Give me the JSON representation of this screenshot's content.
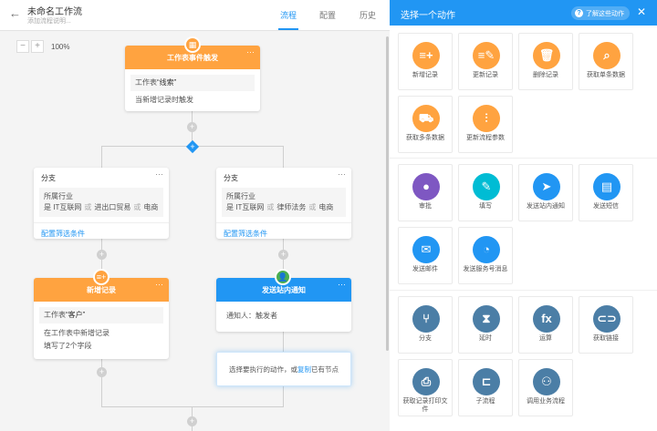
{
  "header": {
    "back_icon": "back-arrow-icon",
    "title": "未命名工作流",
    "description": "添加流程说明...",
    "tabs": [
      {
        "label": "流程",
        "active": true
      },
      {
        "label": "配置",
        "active": false
      },
      {
        "label": "历史",
        "active": false
      }
    ]
  },
  "canvas": {
    "zoom_out": "−",
    "zoom_in": "+",
    "zoom_level": "100%",
    "trigger": {
      "title": "工作表事件触发",
      "icon": "table-icon",
      "sheet_label": "工作表",
      "sheet_name": "“线索”",
      "desc": "当新增记录时触发",
      "more": "···"
    },
    "branches": [
      {
        "title": "分支",
        "more": "···",
        "field": "所属行业",
        "is_label": "是",
        "values": [
          "IT互联网",
          "进出口贸易",
          "电商"
        ],
        "or": "或",
        "footer": "配置筛选条件"
      },
      {
        "title": "分支",
        "more": "···",
        "field": "所属行业",
        "is_label": "是",
        "values": [
          "IT互联网",
          "律师法务",
          "电商"
        ],
        "or": "或",
        "footer": "配置筛选条件"
      }
    ],
    "add_record_node": {
      "title": "新增记录",
      "icon": "add-record-icon",
      "more": "···",
      "sheet_label": "工作表",
      "sheet_name": "“客户”",
      "line1": "在工作表中新增记录",
      "line2": "填写了2个字段"
    },
    "notify_node": {
      "title": "发送站内通知",
      "icon": "user-icon",
      "more": "···",
      "line1": "通知人：触发者"
    },
    "hint": {
      "before": "选择要执行的动作，或",
      "link": "复制",
      "after": "已有节点"
    }
  },
  "panel": {
    "title": "选择一个动作",
    "learn_label": "了解这些动作",
    "learn_icon": "help-icon",
    "close_icon": "close-icon",
    "groups": [
      [
        {
          "label": "新增记录",
          "icon": "add-record-icon",
          "glyph": "≡+",
          "color": "#ffa340"
        },
        {
          "label": "更新记录",
          "icon": "edit-record-icon",
          "glyph": "≡✎",
          "color": "#ffa340"
        },
        {
          "label": "删除记录",
          "icon": "trash-icon",
          "glyph": "🗑",
          "color": "#ffa340"
        },
        {
          "label": "获取单条数据",
          "icon": "search-icon",
          "glyph": "⌕",
          "color": "#ffa340"
        },
        {
          "label": "获取多条数据",
          "icon": "truck-icon",
          "glyph": "⛟",
          "color": "#ffa340"
        },
        {
          "label": "更新流程参数",
          "icon": "sliders-icon",
          "glyph": "⫶",
          "color": "#ffa340"
        }
      ],
      [
        {
          "label": "审批",
          "icon": "approver-icon",
          "glyph": "●",
          "color": "#7e57c2"
        },
        {
          "label": "填写",
          "icon": "pen-icon",
          "glyph": "✎",
          "color": "#00bcd4"
        },
        {
          "label": "发送站内通知",
          "icon": "send-icon",
          "glyph": "➤",
          "color": "#2196f3"
        },
        {
          "label": "发送短信",
          "icon": "sms-icon",
          "glyph": "▤",
          "color": "#2196f3"
        },
        {
          "label": "发送邮件",
          "icon": "mail-icon",
          "glyph": "✉",
          "color": "#2196f3"
        },
        {
          "label": "发送服务号消息",
          "icon": "wechat-icon",
          "glyph": "◔",
          "color": "#2196f3"
        }
      ],
      [
        {
          "label": "分支",
          "icon": "branch-icon",
          "glyph": "⑂",
          "color": "#4b7ea6"
        },
        {
          "label": "延时",
          "icon": "hourglass-icon",
          "glyph": "⧗",
          "color": "#4b7ea6"
        },
        {
          "label": "运算",
          "icon": "fx-icon",
          "glyph": "fx",
          "color": "#4b7ea6"
        },
        {
          "label": "获取链接",
          "icon": "link-icon",
          "glyph": "⊂⊃",
          "color": "#4b7ea6"
        },
        {
          "label": "获取记录打印文件",
          "icon": "printer-icon",
          "glyph": "⎙",
          "color": "#4b7ea6"
        },
        {
          "label": "子流程",
          "icon": "subflow-icon",
          "glyph": "⊏",
          "color": "#4b7ea6"
        },
        {
          "label": "调用业务流程",
          "icon": "process-icon",
          "glyph": "⚇",
          "color": "#4b7ea6"
        }
      ]
    ]
  }
}
